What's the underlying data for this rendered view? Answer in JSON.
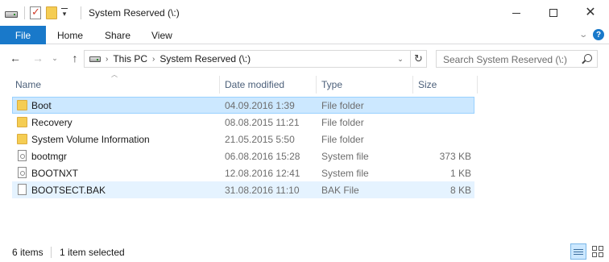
{
  "window": {
    "title": "System Reserved (\\:)"
  },
  "ribbon": {
    "tabs": [
      "File",
      "Home",
      "Share",
      "View"
    ]
  },
  "address": {
    "crumbs": [
      "This PC",
      "System Reserved (\\:)"
    ]
  },
  "search": {
    "placeholder": "Search System Reserved (\\:)"
  },
  "columns": {
    "name": "Name",
    "date": "Date modified",
    "type": "Type",
    "size": "Size"
  },
  "files": [
    {
      "name": "Boot",
      "date": "04.09.2016 1:39",
      "type": "File folder",
      "size": "",
      "icon": "folder-icon"
    },
    {
      "name": "Recovery",
      "date": "08.08.2015 11:21",
      "type": "File folder",
      "size": "",
      "icon": "folder-icon"
    },
    {
      "name": "System Volume Information",
      "date": "21.05.2015 5:50",
      "type": "File folder",
      "size": "",
      "icon": "folder-icon"
    },
    {
      "name": "bootmgr",
      "date": "06.08.2016 15:28",
      "type": "System file",
      "size": "373 KB",
      "icon": "system-file-icon"
    },
    {
      "name": "BOOTNXT",
      "date": "12.08.2016 12:41",
      "type": "System file",
      "size": "1 KB",
      "icon": "system-file-icon"
    },
    {
      "name": "BOOTSECT.BAK",
      "date": "31.08.2016 11:10",
      "type": "BAK File",
      "size": "8 KB",
      "icon": "file-icon"
    }
  ],
  "status": {
    "count": "6 items",
    "selection": "1 item selected"
  },
  "colors": {
    "file_tab": "#1979ca",
    "selected_row": "#cce8ff",
    "hover_row": "#e5f3ff",
    "column_header_text": "#4c607a"
  }
}
